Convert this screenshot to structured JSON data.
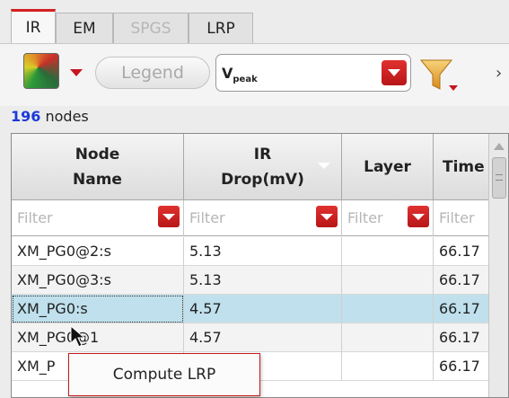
{
  "tabs": [
    {
      "label": "IR",
      "active": true,
      "enabled": true
    },
    {
      "label": "EM",
      "active": false,
      "enabled": true
    },
    {
      "label": "SPGS",
      "active": false,
      "enabled": false
    },
    {
      "label": "LRP",
      "active": false,
      "enabled": true
    }
  ],
  "toolbar": {
    "legend_label": "Legend",
    "legend_enabled": false,
    "metric_value": "V",
    "metric_value_sub": "peak",
    "more_glyph": "›"
  },
  "node_count": {
    "number": "196",
    "suffix": " nodes"
  },
  "table": {
    "columns": [
      {
        "label": "Node\nName"
      },
      {
        "label": "IR\nDrop(mV)",
        "sorted": true
      },
      {
        "label": "Layer"
      },
      {
        "label": "Time"
      }
    ],
    "filter_placeholder": "Filter",
    "rows": [
      {
        "node": "XM_PG0@2:s",
        "drop": "5.13",
        "layer": "",
        "time": "66.17",
        "state": "normal"
      },
      {
        "node": "XM_PG0@3:s",
        "drop": "5.13",
        "layer": "",
        "time": "66.17",
        "state": "alt"
      },
      {
        "node": "XM_PG0:s",
        "drop": "4.57",
        "layer": "",
        "time": "66.17",
        "state": "selected"
      },
      {
        "node": "XM_PG0@1",
        "drop": "4.57",
        "layer": "",
        "time": "66.17",
        "state": "alt"
      },
      {
        "node": "XM_P",
        "drop": "",
        "layer": "",
        "time": "66.17",
        "state": "normal"
      }
    ]
  },
  "context_menu": {
    "items": [
      {
        "label": "Compute LRP"
      }
    ]
  },
  "colors": {
    "accent_red": "#c8141e",
    "count_blue": "#1a3ad8",
    "selected_row": "#bfe0ec"
  }
}
